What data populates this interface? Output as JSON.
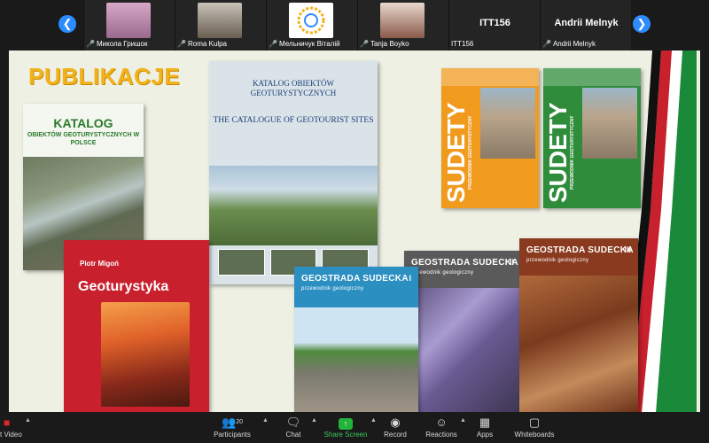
{
  "participants": [
    {
      "name": "Микола Гришок",
      "muted": true
    },
    {
      "name": "Roma Kulpa",
      "muted": true
    },
    {
      "name": "Мельничук Віталій",
      "muted": true
    },
    {
      "name": "Tanja Boyko",
      "muted": true
    },
    {
      "name": "ITT156",
      "display": "ITT156",
      "muted": false
    },
    {
      "name": "Andrii Melnyk",
      "display": "Andrii Melnyk",
      "muted": true
    }
  ],
  "slide": {
    "title": "PUBLIKACJE",
    "books": {
      "katalog": {
        "title": "KATALOG",
        "subtitle": "OBIEKTÓW GEOTURYSTYCZNYCH W POLSCE"
      },
      "catalogue": {
        "pl_title": "KATALOG OBIEKTÓW GEOTURYSTYCZNYCH",
        "en_title": "THE CATALOGUE OF GEOTOURIST SITES"
      },
      "sudety": {
        "title": "SUDETY",
        "subtitle": "PRZEWODNIK GEOTURYSTYCZNY"
      },
      "geoturystyka": {
        "author": "Piotr Migoń",
        "title": "Geoturystyka"
      },
      "geostrada": {
        "title": "GEOSTRADA SUDECKA",
        "subtitle": "przewodnik geologiczny",
        "volumes": [
          "I",
          "II",
          "III"
        ]
      }
    }
  },
  "toolbar": {
    "stop_video": "t Video",
    "participants": "Participants",
    "participants_count": "20",
    "chat": "Chat",
    "share_screen": "Share Screen",
    "record": "Record",
    "reactions": "Reactions",
    "apps": "Apps",
    "whiteboards": "Whiteboards"
  },
  "icons": {
    "prev": "chevron-left-icon",
    "next": "chevron-right-icon",
    "mic_muted": "mic-muted-icon"
  },
  "colors": {
    "accent": "#2d8cff",
    "share_green": "#22b33a",
    "title_gold": "#f2b21c"
  }
}
